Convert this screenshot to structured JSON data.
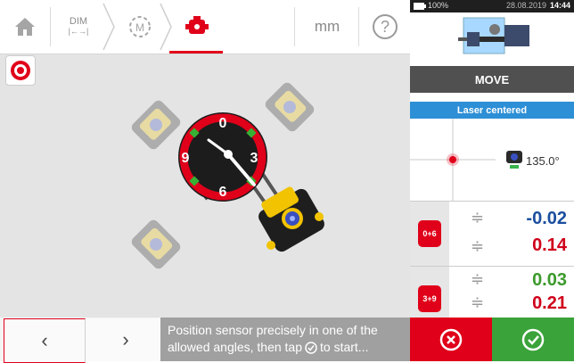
{
  "toolbar": {
    "dim_top": "DIM",
    "dim_arrow": "|←→|",
    "unit": "mm",
    "help": "?"
  },
  "icons": {
    "home": "home-icon",
    "rpm": "tachometer-icon",
    "measure": "sensor-measure-icon",
    "sensor": "sensor-target-icon"
  },
  "dial": {
    "labels": [
      "0",
      "3",
      "6",
      "9"
    ]
  },
  "message": {
    "line1": "Position sensor precisely in one of the",
    "line2": "allowed angles, then tap",
    "line2_end": "to start..."
  },
  "nav": {
    "prev": "‹",
    "next": "›"
  },
  "status": {
    "battery": "100%",
    "datetime": "28.08.2019",
    "time": "14:44"
  },
  "panel": {
    "move_label": "MOVE",
    "laser_status": "Laser centered",
    "angle": "135.0°",
    "row1_tag": "0+6",
    "row1_top": "-0.02",
    "row1_bottom": "0.14",
    "row2_tag": "3+9",
    "row2_top": "0.03",
    "row2_bottom": "0.21"
  },
  "colors": {
    "accent": "#e0001a",
    "blue": "#2d8fd6",
    "green": "#3aa33a",
    "value_blue": "#1a4e9e",
    "value_red": "#d0001a",
    "value_green": "#3c9a2c"
  }
}
